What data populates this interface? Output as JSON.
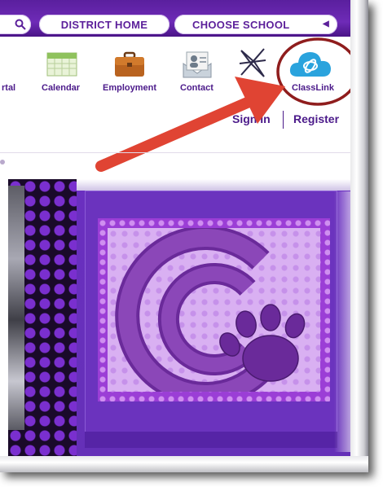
{
  "topbar": {
    "district_home": "DISTRICT HOME",
    "choose_school": "CHOOSE SCHOOL"
  },
  "nav": {
    "items": [
      {
        "label": "rtal",
        "icon": "portal-icon"
      },
      {
        "label": "Calendar",
        "icon": "calendar-icon"
      },
      {
        "label": "Employment",
        "icon": "briefcase-icon"
      },
      {
        "label": "Contact",
        "icon": "contact-card-icon"
      },
      {
        "label": "",
        "icon": "compass-star-icon"
      },
      {
        "label": "ClassLink",
        "icon": "classlink-cloud-icon"
      }
    ]
  },
  "auth": {
    "sign_in": "Sign In",
    "register": "Register"
  },
  "colors": {
    "brand_purple": "#5a1f9e",
    "annotation_red": "#e04433",
    "circle_red": "#8f1d1d",
    "classlink_blue": "#2aa3dd"
  }
}
